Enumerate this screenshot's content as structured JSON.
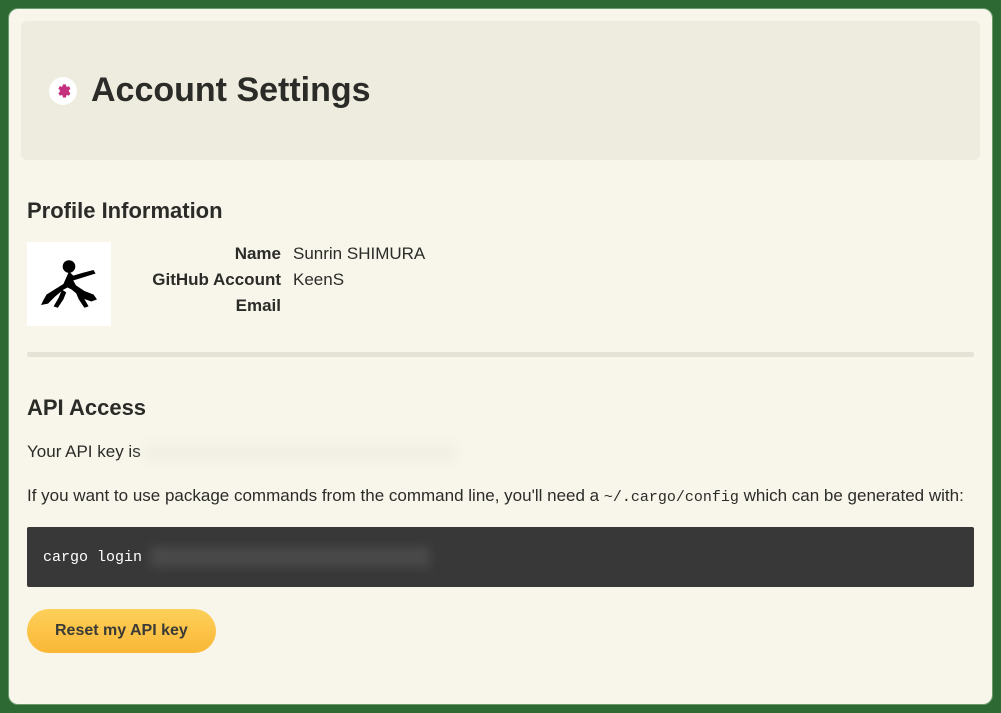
{
  "header": {
    "title": "Account Settings"
  },
  "profile": {
    "section_title": "Profile Information",
    "labels": {
      "name": "Name",
      "github": "GitHub Account",
      "email": "Email"
    },
    "values": {
      "name": "Sunrin SHIMURA",
      "github": "KeenS",
      "email": ""
    }
  },
  "api": {
    "section_title": "API Access",
    "key_prefix": "Your API key is ",
    "explain_prefix": "If you want to use package commands from the command line, you'll need a ",
    "config_path": "~/.cargo/config",
    "explain_suffix": " which can be generated with:",
    "code_prefix": "cargo login ",
    "reset_button": "Reset my API key"
  }
}
